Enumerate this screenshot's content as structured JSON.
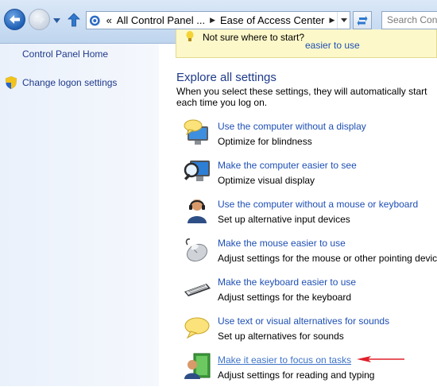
{
  "navigation": {
    "address_crumbs": [
      "All Control Panel ...",
      "Ease of Access Center"
    ],
    "address_overflow": "«",
    "search_placeholder": "Search Control Panel"
  },
  "left_pane": {
    "links": [
      {
        "label": "Control Panel Home",
        "icon": null
      },
      {
        "label": "Change logon settings",
        "icon": "shield-icon"
      }
    ]
  },
  "notice": {
    "question": "Not sure where to start?",
    "link": "easier to use"
  },
  "explore": {
    "heading": "Explore all settings",
    "description": "When you select these settings, they will automatically start each time you log on."
  },
  "settings": [
    {
      "title": "Use the computer without a display",
      "subtitle": "Optimize for blindness",
      "icon": "speech-bubble-monitor-icon"
    },
    {
      "title": "Make the computer easier to see",
      "subtitle": "Optimize visual display",
      "icon": "magnifier-monitor-icon"
    },
    {
      "title": "Use the computer without a mouse or keyboard",
      "subtitle": "Set up alternative input devices",
      "icon": "user-headset-icon"
    },
    {
      "title": "Make the mouse easier to use",
      "subtitle": "Adjust settings for the mouse or other pointing devices",
      "icon": "mouse-icon"
    },
    {
      "title": "Make the keyboard easier to use",
      "subtitle": "Adjust settings for the keyboard",
      "icon": "keyboard-icon"
    },
    {
      "title": "Use text or visual alternatives for sounds",
      "subtitle": "Set up alternatives for sounds",
      "icon": "speech-bubble-icon"
    },
    {
      "title": "Make it easier to focus on tasks",
      "subtitle": "Adjust settings for reading and typing",
      "icon": "focus-tasks-icon"
    }
  ],
  "colors": {
    "link": "#1e4fb4",
    "annotation_arrow": "#e0202a",
    "notice_background": "#fcf8c9"
  }
}
